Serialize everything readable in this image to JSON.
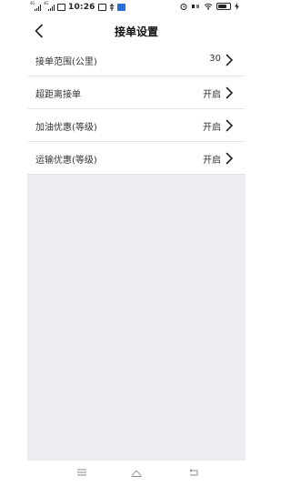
{
  "status_bar": {
    "time": "10:26",
    "signal1_label": "4G",
    "signal2_label": "4G"
  },
  "header": {
    "title": "接单设置",
    "back_icon": "chevron-left-icon"
  },
  "settings": {
    "items": [
      {
        "label": "接单范围(公里)",
        "value": "30"
      },
      {
        "label": "超距离接单",
        "value": "开启"
      },
      {
        "label": "加油优惠(等级)",
        "value": "开启"
      },
      {
        "label": "运输优惠(等级)",
        "value": "开启"
      }
    ]
  },
  "system_nav": {
    "icons": [
      "menu-icon",
      "home-icon",
      "back-icon"
    ]
  },
  "colors": {
    "background": "#ededf1",
    "row_background": "#ffffff",
    "divider": "#e6e6ea",
    "text": "#333333"
  }
}
